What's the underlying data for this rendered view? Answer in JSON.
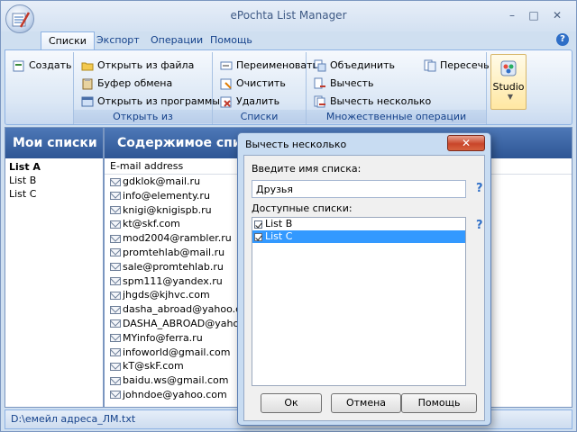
{
  "window": {
    "title": "ePochta List Manager",
    "min": "–",
    "max": "□",
    "close": "✕"
  },
  "tabs": [
    {
      "label": "Списки",
      "active": true
    },
    {
      "label": "Экспорт"
    },
    {
      "label": "Операции"
    },
    {
      "label": "Помощь"
    }
  ],
  "ribbon": {
    "create": "Создать",
    "open_group": {
      "label": "Открыть из",
      "items": [
        "Открыть из файла",
        "Буфер обмена",
        "Открыть из программы"
      ]
    },
    "lists_group": {
      "label": "Списки",
      "items": [
        "Переименовать",
        "Очистить",
        "Удалить"
      ]
    },
    "multi_group": {
      "label": "Множественные операции",
      "items": [
        "Объединить",
        "Вычесть",
        "Вычесть несколько",
        "Пересечь"
      ]
    },
    "studio": "Studio"
  },
  "left": {
    "header": "Мои списки",
    "lists": [
      "List A",
      "List B",
      "List C"
    ]
  },
  "right": {
    "header": "Содержимое списка",
    "column": "E-mail address",
    "emails": [
      "gdklok@mail.ru",
      "info@elementy.ru",
      "knigi@knigispb.ru",
      "kt@skf.com",
      "mod2004@rambler.ru",
      "promtehlab@mail.ru",
      "sale@promtehlab.ru",
      "spm111@yandex.ru",
      "jhgds@kjhvc.com",
      "dasha_abroad@yahoo.c...",
      "DASHA_ABROAD@yaho...",
      "MYinfo@ferra.ru",
      "infoworld@gmail.com",
      "kT@skF.com",
      "baidu.ws@gmail.com",
      "johndoe@yahoo.com"
    ]
  },
  "status": "D:\\емейл адреса_ЛМ.txt",
  "dialog": {
    "title": "Вычесть несколько",
    "name_label": "Введите имя списка:",
    "name_value": "Друзья",
    "help": "?",
    "available_label": "Доступные списки:",
    "available": [
      {
        "label": "List B",
        "checked": true
      },
      {
        "label": "List C",
        "checked": true,
        "selected": true
      }
    ],
    "ok": "Ок",
    "cancel": "Отмена",
    "help_btn": "Помощь"
  }
}
